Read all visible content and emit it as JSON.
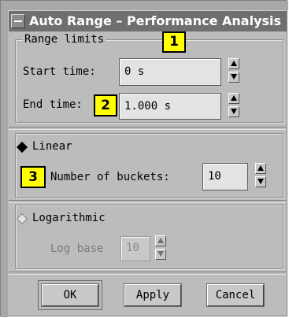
{
  "window": {
    "title": "Auto Range – Performance Analysis"
  },
  "range_limits": {
    "legend": "Range limits",
    "start_label": "Start time:",
    "start_value": "0 s",
    "end_label": "End time:",
    "end_value": "1.000 s"
  },
  "linear": {
    "label": "Linear",
    "selected": true,
    "buckets_label": "Number of buckets:",
    "buckets_value": "10"
  },
  "logarithmic": {
    "label": "Logarithmic",
    "selected": false,
    "log_base_label": "Log base",
    "log_base_value": "10"
  },
  "callouts": [
    "1",
    "2",
    "3"
  ],
  "buttons": {
    "ok": "OK",
    "apply": "Apply",
    "cancel": "Cancel"
  }
}
